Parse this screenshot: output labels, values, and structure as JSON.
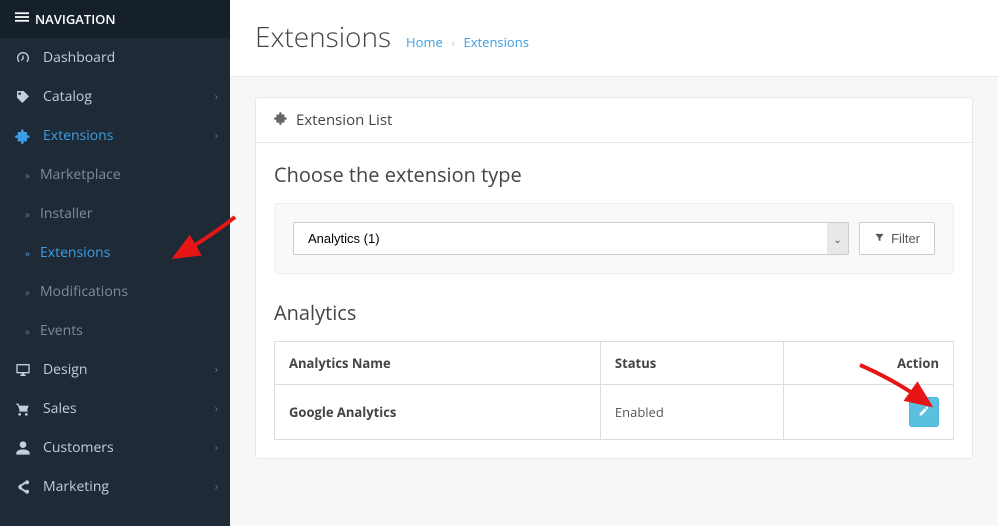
{
  "sidebar": {
    "header": "NAVIGATION",
    "items": [
      {
        "label": "Dashboard",
        "icon": "dashboard"
      },
      {
        "label": "Catalog",
        "icon": "tag"
      },
      {
        "label": "Extensions",
        "icon": "puzzle",
        "active": true
      },
      {
        "label": "Design",
        "icon": "desktop"
      },
      {
        "label": "Sales",
        "icon": "cart"
      },
      {
        "label": "Customers",
        "icon": "user"
      },
      {
        "label": "Marketing",
        "icon": "share"
      }
    ],
    "subitems": [
      {
        "label": "Marketplace"
      },
      {
        "label": "Installer"
      },
      {
        "label": "Extensions",
        "active": true
      },
      {
        "label": "Modifications"
      },
      {
        "label": "Events"
      }
    ]
  },
  "header": {
    "title": "Extensions",
    "breadcrumb_home": "Home",
    "breadcrumb_current": "Extensions"
  },
  "panel": {
    "title": "Extension List",
    "choose_title": "Choose the extension type",
    "select_value": "Analytics (1)",
    "filter_label": "Filter",
    "table_title": "Analytics",
    "columns": [
      "Analytics Name",
      "Status",
      "Action"
    ],
    "rows": [
      {
        "name": "Google Analytics",
        "status": "Enabled"
      }
    ]
  }
}
